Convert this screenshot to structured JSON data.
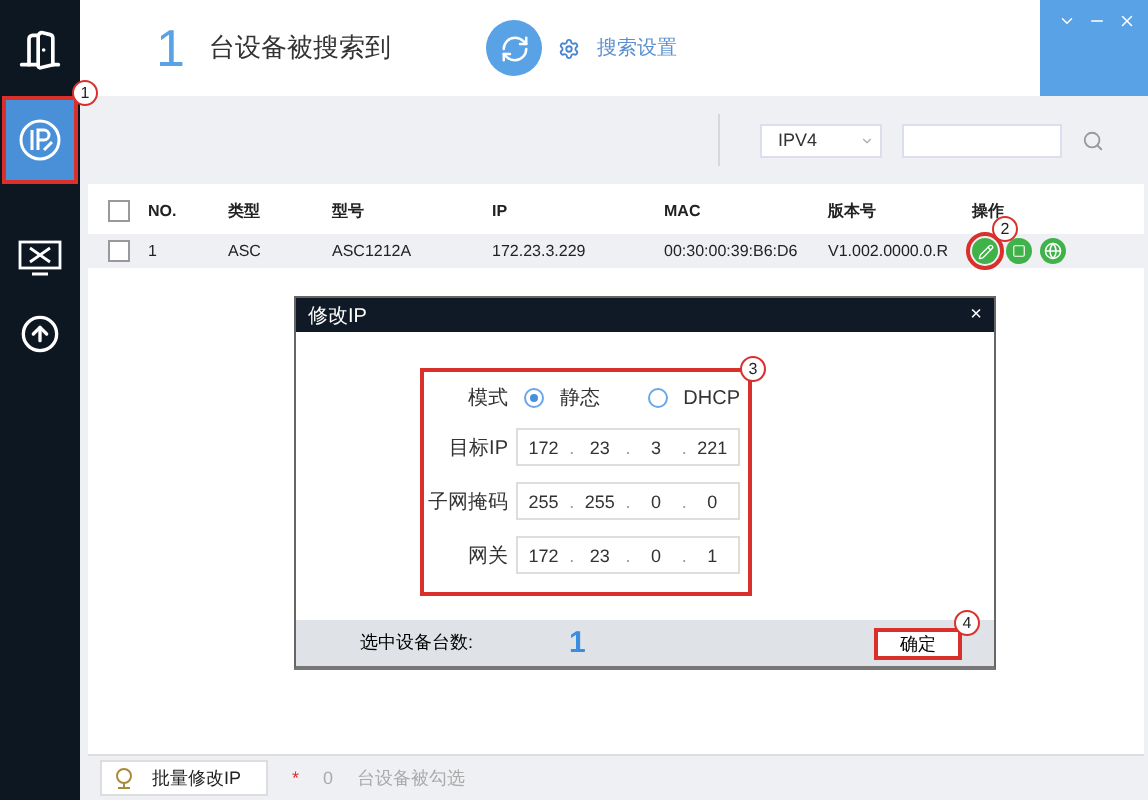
{
  "sidebar": {
    "items": [
      {
        "kind": "exit",
        "selected": false
      },
      {
        "kind": "ip",
        "selected": true,
        "callout": "1"
      },
      {
        "kind": "tools",
        "selected": false
      },
      {
        "kind": "upgrade",
        "selected": false
      }
    ]
  },
  "header": {
    "count": "1",
    "count_label": "台设备被搜索到",
    "settings_label": "搜索设置"
  },
  "filter": {
    "protocol": "IPV4"
  },
  "table": {
    "all_checked": false,
    "columns": [
      "NO.",
      "类型",
      "型号",
      "IP",
      "MAC",
      "版本号",
      "操作"
    ],
    "rows": [
      {
        "checked": false,
        "cells": [
          "1",
          "ASC",
          "ASC1212A",
          "172.23.3.229",
          "00:30:00:39:B6:D6",
          "V1.002.0000.0.R"
        ],
        "actions": [
          {
            "kind": "edit",
            "callout": "2"
          },
          {
            "kind": "device"
          },
          {
            "kind": "browser"
          }
        ]
      }
    ]
  },
  "dialog": {
    "title": "修改IP",
    "close": "×",
    "form": {
      "callout": "3",
      "mode_label": "模式",
      "modes": [
        {
          "label": "静态",
          "selected": true
        },
        {
          "label": "DHCP",
          "selected": false
        }
      ],
      "separator": ".",
      "fields": [
        {
          "label": "目标IP",
          "octets": [
            "172",
            "23",
            "3",
            "221"
          ]
        },
        {
          "label": "子网掩码",
          "octets": [
            "255",
            "255",
            "0",
            "0"
          ]
        },
        {
          "label": "网关",
          "octets": [
            "172",
            "23",
            "0",
            "1"
          ]
        }
      ]
    },
    "footer": {
      "selected_label": "选中设备台数:",
      "selected_count": "1",
      "confirm": {
        "label": "确定",
        "callout": "4"
      }
    }
  },
  "bottom_bar": {
    "batch_button": "批量修改IP",
    "mark": "*",
    "count": "0",
    "count_label": "台设备被勾选"
  }
}
